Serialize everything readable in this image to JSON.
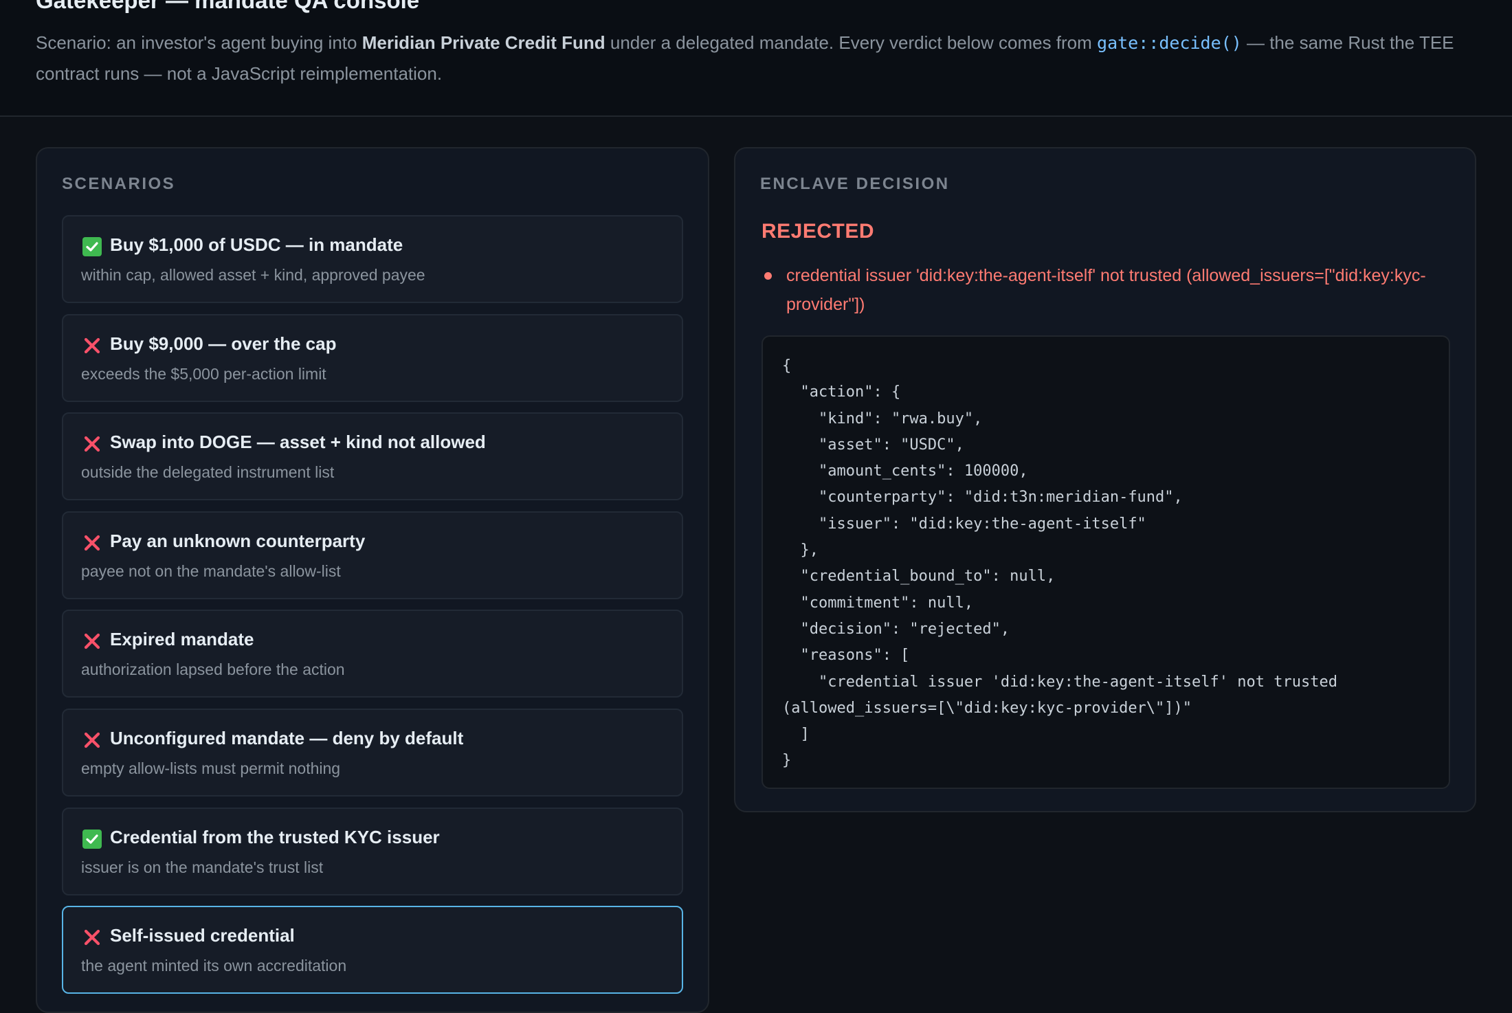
{
  "header": {
    "title": "Gatekeeper — mandate QA console",
    "desc_prefix": "Scenario: an investor's agent buying into ",
    "desc_fund": "Meridian Private Credit Fund",
    "desc_mid": " under a delegated mandate. Every verdict below comes from ",
    "desc_code": "gate::decide()",
    "desc_suffix": " — the same Rust the TEE contract runs — not a JavaScript reimplementation."
  },
  "scenarios": {
    "heading": "SCENARIOS",
    "items": [
      {
        "status": "pass",
        "icon": "check-icon",
        "title": "Buy $1,000 of USDC — in mandate",
        "subtitle": "within cap, allowed asset + kind, approved payee"
      },
      {
        "status": "fail",
        "icon": "cross-icon",
        "title": "Buy $9,000 — over the cap",
        "subtitle": "exceeds the $5,000 per-action limit"
      },
      {
        "status": "fail",
        "icon": "cross-icon",
        "title": "Swap into DOGE — asset + kind not allowed",
        "subtitle": "outside the delegated instrument list"
      },
      {
        "status": "fail",
        "icon": "cross-icon",
        "title": "Pay an unknown counterparty",
        "subtitle": "payee not on the mandate's allow-list"
      },
      {
        "status": "fail",
        "icon": "cross-icon",
        "title": "Expired mandate",
        "subtitle": "authorization lapsed before the action"
      },
      {
        "status": "fail",
        "icon": "cross-icon",
        "title": "Unconfigured mandate — deny by default",
        "subtitle": "empty allow-lists must permit nothing"
      },
      {
        "status": "pass",
        "icon": "check-icon",
        "title": "Credential from the trusted KYC issuer",
        "subtitle": "issuer is on the mandate's trust list"
      },
      {
        "status": "fail",
        "icon": "cross-icon",
        "title": "Self-issued credential",
        "subtitle": "the agent minted its own accreditation",
        "selected": true
      }
    ]
  },
  "decision": {
    "heading": "ENCLAVE DECISION",
    "verdict": "REJECTED",
    "reason": "credential issuer 'did:key:the-agent-itself' not trusted (allowed_issuers=[\"did:key:kyc-provider\"])",
    "json": "{\n  \"action\": {\n    \"kind\": \"rwa.buy\",\n    \"asset\": \"USDC\",\n    \"amount_cents\": 100000,\n    \"counterparty\": \"did:t3n:meridian-fund\",\n    \"issuer\": \"did:key:the-agent-itself\"\n  },\n  \"credential_bound_to\": null,\n  \"commitment\": null,\n  \"decision\": \"rejected\",\n  \"reasons\": [\n    \"credential issuer 'did:key:the-agent-itself' not trusted\n(allowed_issuers=[\\\"did:key:kyc-provider\\\"])\"\n  ]\n}",
    "colors": {
      "rejected": "#ff7b72",
      "pass": "#3fb950",
      "fail": "#f85169",
      "selected_border": "#58b4e6"
    }
  }
}
